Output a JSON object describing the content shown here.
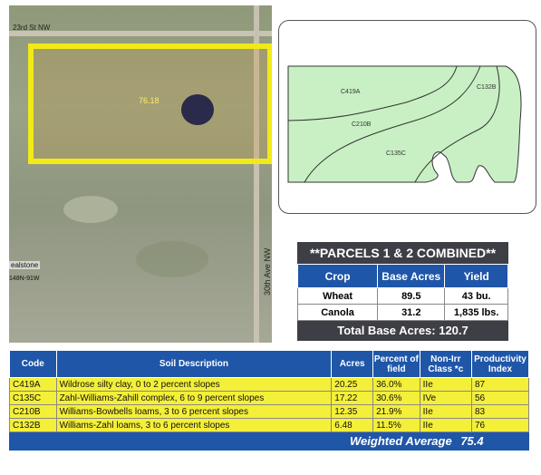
{
  "aerial": {
    "road_top_label": "23rd St NW",
    "road_side_label": "30th Ave NW",
    "label_left1": "ealstone",
    "label_left2": "148N-91W",
    "field_acres": "76.18"
  },
  "soil_map": {
    "units": [
      "C419A",
      "C210B",
      "C135C",
      "C132B"
    ],
    "fill_color": "#c8f0c4"
  },
  "parcels": {
    "title": "**PARCELS 1 & 2 COMBINED**",
    "headers": [
      "Crop",
      "Base Acres",
      "Yield"
    ],
    "rows": [
      {
        "crop": "Wheat",
        "acres": "89.5",
        "yield": "43 bu."
      },
      {
        "crop": "Canola",
        "acres": "31.2",
        "yield": "1,835 lbs."
      }
    ],
    "total": "Total Base Acres: 120.7"
  },
  "soil_table": {
    "headers": [
      "Code",
      "Soil Description",
      "Acres",
      "Percent of field",
      "Non-Irr Class *c",
      "Productivity Index"
    ],
    "rows": [
      {
        "code": "C419A",
        "desc": "Wildrose silty clay, 0 to 2 percent slopes",
        "acres": "20.25",
        "pct": "36.0%",
        "cls": "IIe",
        "pi": "87"
      },
      {
        "code": "C135C",
        "desc": "Zahl-Williams-Zahill complex, 6 to 9 percent slopes",
        "acres": "17.22",
        "pct": "30.6%",
        "cls": "IVe",
        "pi": "56"
      },
      {
        "code": "C210B",
        "desc": "Williams-Bowbells loams, 3 to 6 percent slopes",
        "acres": "12.35",
        "pct": "21.9%",
        "cls": "IIe",
        "pi": "83"
      },
      {
        "code": "C132B",
        "desc": "Williams-Zahl loams, 3 to 6 percent slopes",
        "acres": "6.48",
        "pct": "11.5%",
        "cls": "IIe",
        "pi": "76"
      }
    ],
    "weighted_label": "Weighted Average",
    "weighted_value": "75.4"
  }
}
